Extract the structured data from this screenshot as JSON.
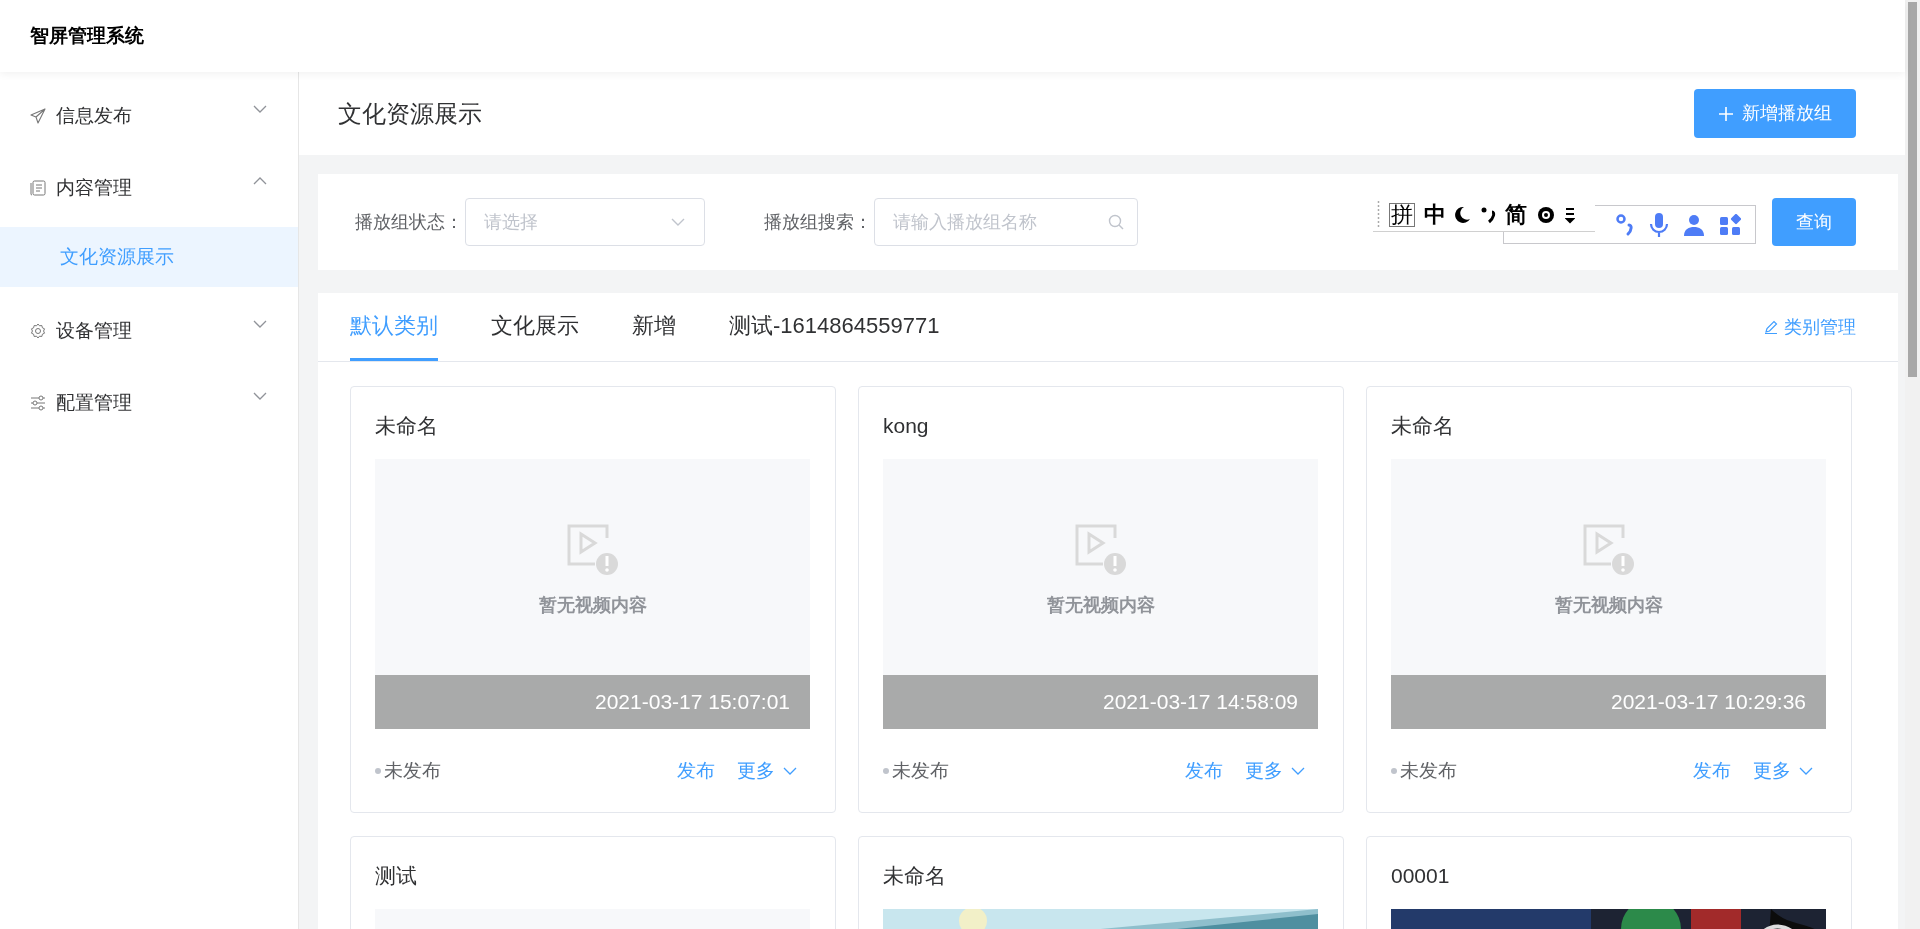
{
  "app": {
    "title": "智屏管理系统"
  },
  "sidebar": {
    "items": [
      {
        "label": "信息发布",
        "expanded": false,
        "selected": false
      },
      {
        "label": "内容管理",
        "expanded": true,
        "selected": false,
        "children": [
          {
            "label": "文化资源展示",
            "selected": true
          }
        ]
      },
      {
        "label": "设备管理",
        "expanded": false,
        "selected": false
      },
      {
        "label": "配置管理",
        "expanded": false,
        "selected": false
      }
    ]
  },
  "page": {
    "title": "文化资源展示",
    "add_button": "新增播放组"
  },
  "filters": [
    {
      "kind": "select",
      "label": "播放组状态：",
      "placeholder": "请选择"
    },
    {
      "kind": "search",
      "label": "播放组搜索：",
      "placeholder": "请输入播放组名称"
    }
  ],
  "query_button": "查询",
  "ime_toolbar": {
    "texts": [
      "拼",
      "中",
      "简"
    ]
  },
  "tabs": [
    {
      "label": "默认类别",
      "selected": true
    },
    {
      "label": "文化展示",
      "selected": false
    },
    {
      "label": "新增",
      "selected": false
    },
    {
      "label": "测试-1614864559771",
      "selected": false
    }
  ],
  "manage_link": "类别管理",
  "cards": [
    {
      "title": "未命名",
      "kind": "empty",
      "empty_text": "暂无视频内容",
      "time": "2021-03-17 15:07:01",
      "status": "未发布",
      "actions": [
        "发布",
        "更多"
      ]
    },
    {
      "title": "kong",
      "kind": "empty",
      "empty_text": "暂无视频内容",
      "time": "2021-03-17 14:58:09",
      "status": "未发布",
      "actions": [
        "发布",
        "更多"
      ]
    },
    {
      "title": "未命名",
      "kind": "empty",
      "empty_text": "暂无视频内容",
      "time": "2021-03-17 10:29:36",
      "status": "未发布",
      "actions": [
        "发布",
        "更多"
      ]
    },
    {
      "title": "测试",
      "kind": "empty"
    },
    {
      "title": "未命名",
      "kind": "picture"
    },
    {
      "title": "00001",
      "kind": "picture"
    }
  ]
}
